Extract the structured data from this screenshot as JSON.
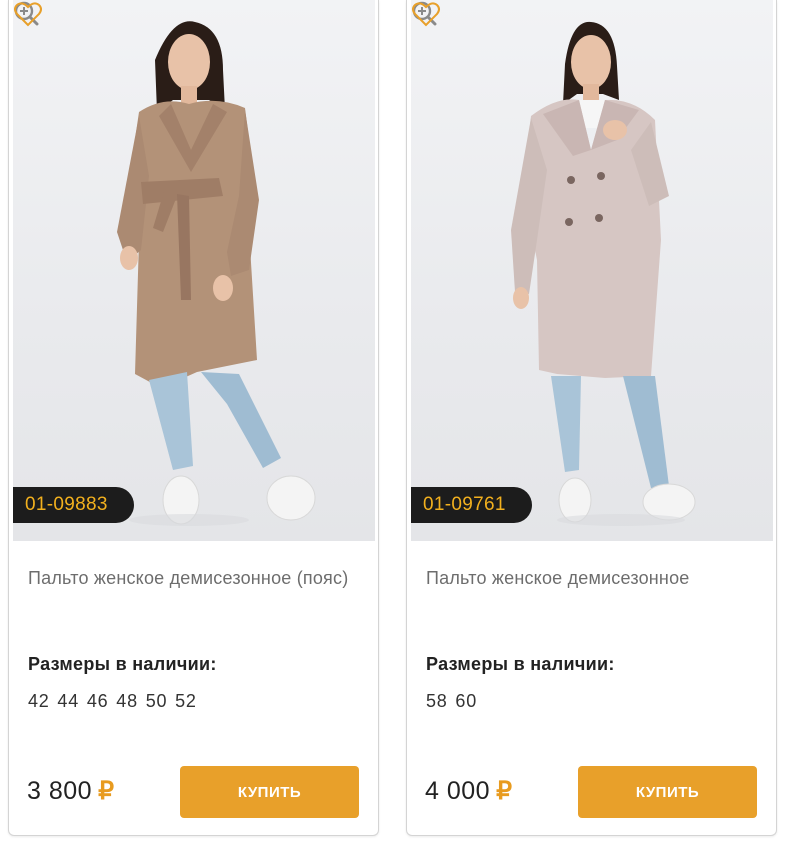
{
  "products": [
    {
      "sku": "01-09883",
      "title": "Пальто женское демисезонное (пояс)",
      "sizes_label": "Размеры в наличии:",
      "sizes": "42 44 46 48 50 52",
      "price": "3 800",
      "currency": "₽",
      "buy_label": "КУПИТЬ",
      "image_icon": "product-photo",
      "zoom_icon": "zoom-in-icon",
      "favorite_icon": "heart-icon"
    },
    {
      "sku": "01-09761",
      "title": "Пальто женское демисезонное",
      "sizes_label": "Размеры в наличии:",
      "sizes": "58 60",
      "price": "4 000",
      "currency": "₽",
      "buy_label": "КУПИТЬ",
      "image_icon": "product-photo",
      "zoom_icon": "zoom-in-icon",
      "favorite_icon": "heart-icon"
    }
  ],
  "colors": {
    "accent": "#e8a02a",
    "sku_badge_bg": "#1c1c1c",
    "sku_badge_text": "#f2b01e",
    "coat_1": "#b39278",
    "coat_2": "#d6c6c3",
    "jeans": "#a9c4d8"
  }
}
